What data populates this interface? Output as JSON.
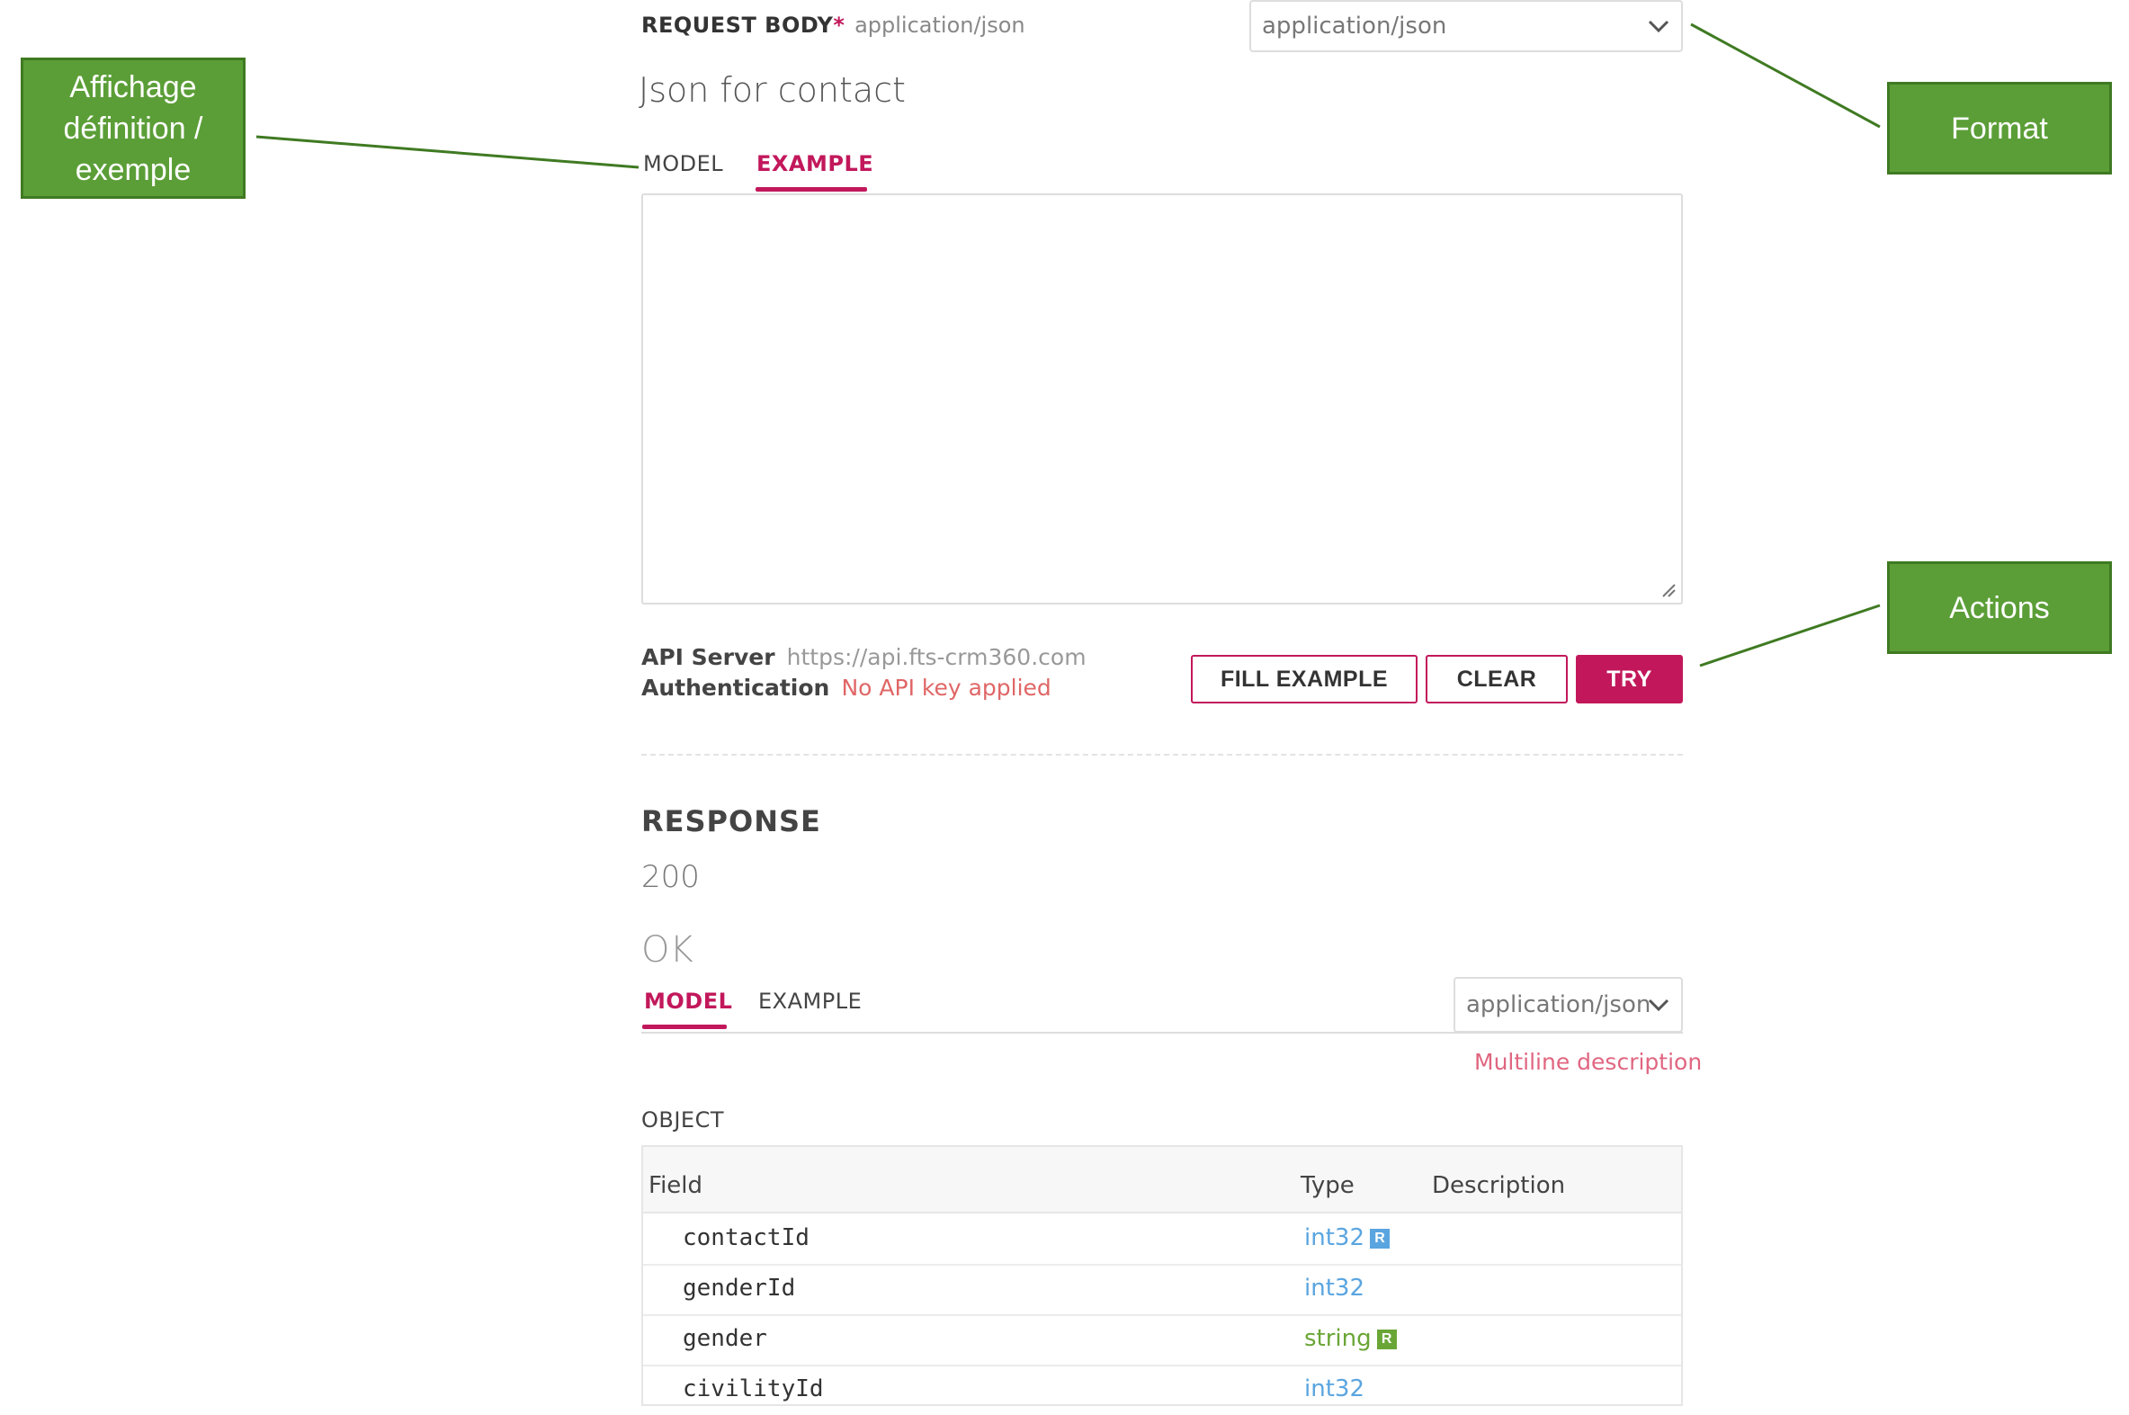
{
  "request_body": {
    "label": "REQUEST BODY",
    "required_mark": "*",
    "content_type": "application/json",
    "format_select": "application/json",
    "title": "Json for contact",
    "tabs": [
      {
        "label": "MODEL",
        "active": false
      },
      {
        "label": "EXAMPLE",
        "active": true
      }
    ],
    "example_value": ""
  },
  "server_info": {
    "api_server_key": "API Server",
    "api_server_value": "https://api.fts-crm360.com",
    "auth_key": "Authentication",
    "auth_value": "No API key applied"
  },
  "actions": {
    "fill_example": "FILL EXAMPLE",
    "clear": "CLEAR",
    "try": "TRY"
  },
  "response": {
    "title": "RESPONSE",
    "code": "200",
    "status": "OK",
    "tabs": [
      {
        "label": "MODEL",
        "active": true
      },
      {
        "label": "EXAMPLE",
        "active": false
      }
    ],
    "format_select": "application/json",
    "multiline_link": "Multiline description",
    "object_label": "OBJECT",
    "table": {
      "headers": [
        "Field",
        "Type",
        "Description"
      ],
      "rows": [
        {
          "field": "contactId",
          "type": "int32",
          "required": true,
          "kind": "int"
        },
        {
          "field": "genderId",
          "type": "int32",
          "required": false,
          "kind": "int"
        },
        {
          "field": "gender",
          "type": "string",
          "required": true,
          "kind": "str"
        },
        {
          "field": "civilityId",
          "type": "int32",
          "required": false,
          "kind": "int"
        }
      ],
      "required_badge": "R"
    }
  },
  "annotations": {
    "tabs_callout": "Affichage définition / exemple",
    "format_callout": "Format",
    "actions_callout": "Actions"
  },
  "colors": {
    "accent": "#c2185b",
    "callout": "#5b9e37",
    "int_type": "#5aa5e0",
    "string_type": "#6aa636"
  },
  "icons": {
    "select_chevron": "chevron-down-icon",
    "textarea_resize": "resize-grip-icon",
    "required_badge": "required-badge"
  }
}
